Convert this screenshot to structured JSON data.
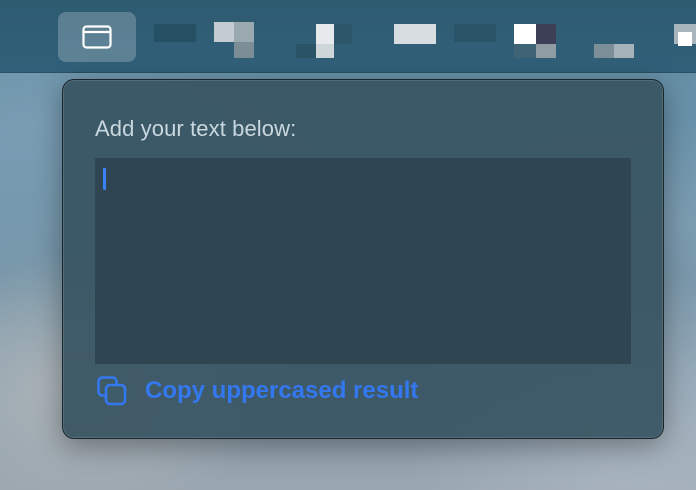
{
  "menubar": {
    "active_item_icon": "window-icon"
  },
  "popover": {
    "heading": "Add your text below:",
    "input_value": "",
    "copy_action_label": "Copy uppercased result",
    "copy_icon": "copy-icon"
  },
  "colors": {
    "accent": "#3478f0",
    "menubar_bg": "#2e5b70",
    "popover_bg": "#385462",
    "textarea_bg": "#2f4551",
    "heading_text": "#c9d7de"
  }
}
